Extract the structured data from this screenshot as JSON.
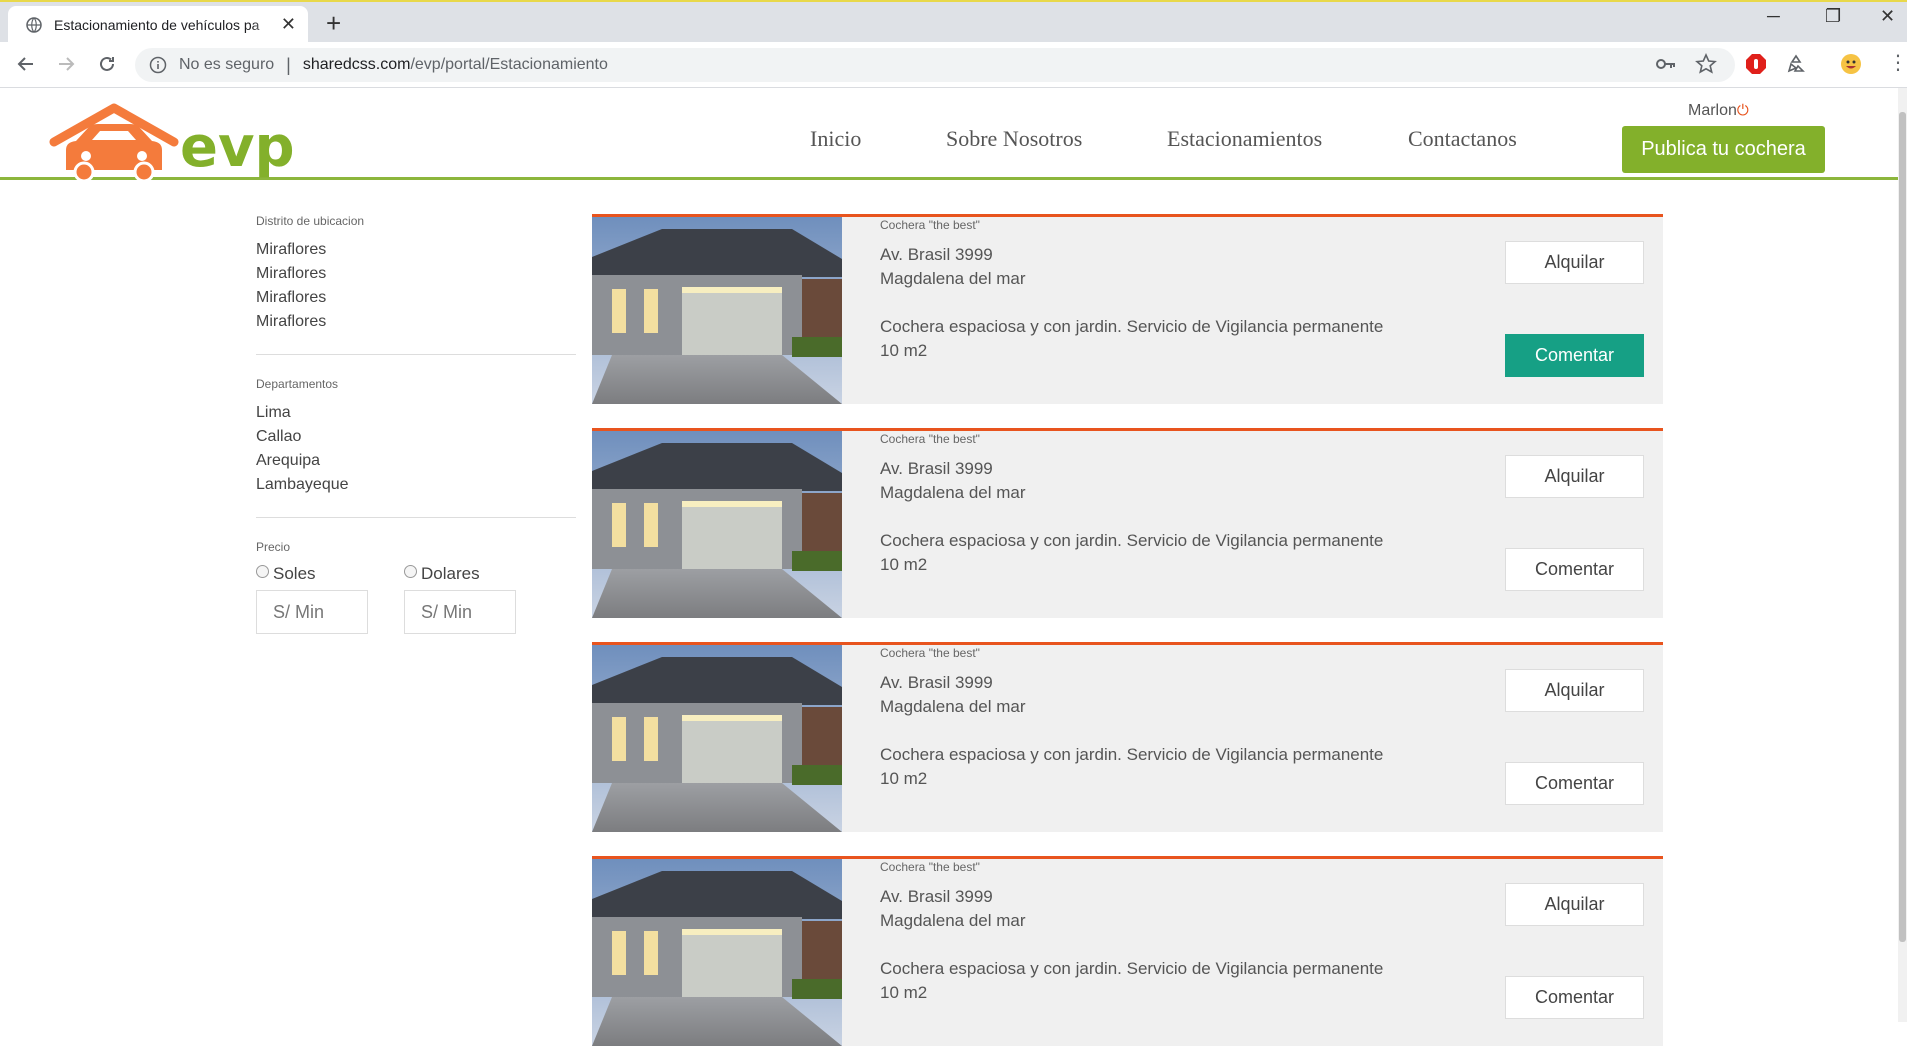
{
  "browser": {
    "tab_title": "Estacionamiento de vehículos pa",
    "security_label": "No es seguro",
    "url_host": "sharedcss.com",
    "url_path": "/evp/portal/Estacionamiento"
  },
  "site": {
    "logo_text": "evp",
    "nav": [
      "Inicio",
      "Sobre Nosotros",
      "Estacionamientos",
      "Contactanos"
    ],
    "user_name": "Marlon",
    "publish_label": "Publica tu cochera"
  },
  "filters": {
    "district": {
      "title": "Distrito de ubicacion",
      "options": [
        "Miraflores",
        "Miraflores",
        "Miraflores",
        "Miraflores"
      ]
    },
    "departments": {
      "title": "Departamentos",
      "options": [
        "Lima",
        "Callao",
        "Arequipa",
        "Lambayeque"
      ]
    },
    "price": {
      "title": "Precio",
      "soles_label": "Soles",
      "dolares_label": "Dolares",
      "soles_placeholder": "S/ Min",
      "dolares_placeholder": "S/ Min"
    }
  },
  "listings": [
    {
      "name": "Cochera \"the best\"",
      "street": "Av. Brasil 3999",
      "district": "Magdalena del mar",
      "description": "Cochera espaciosa y con jardin. Servicio de Vigilancia permanente",
      "area": "10 m2",
      "rent_label": "Alquilar",
      "comment_label": "Comentar"
    },
    {
      "name": "Cochera \"the best\"",
      "street": "Av. Brasil 3999",
      "district": "Magdalena del mar",
      "description": "Cochera espaciosa y con jardin. Servicio de Vigilancia permanente",
      "area": "10 m2",
      "rent_label": "Alquilar",
      "comment_label": "Comentar"
    },
    {
      "name": "Cochera \"the best\"",
      "street": "Av. Brasil 3999",
      "district": "Magdalena del mar",
      "description": "Cochera espaciosa y con jardin. Servicio de Vigilancia permanente",
      "area": "10 m2",
      "rent_label": "Alquilar",
      "comment_label": "Comentar"
    },
    {
      "name": "Cochera \"the best\"",
      "street": "Av. Brasil 3999",
      "district": "Magdalena del mar",
      "description": "Cochera espaciosa y con jardin. Servicio de Vigilancia permanente",
      "area": "10 m2",
      "rent_label": "Alquilar",
      "comment_label": "Comentar"
    }
  ],
  "colors": {
    "brand_green": "#83b02b",
    "accent_orange": "#e8541e",
    "comment_active": "#16a085",
    "logo_orange": "#f47b3c"
  }
}
